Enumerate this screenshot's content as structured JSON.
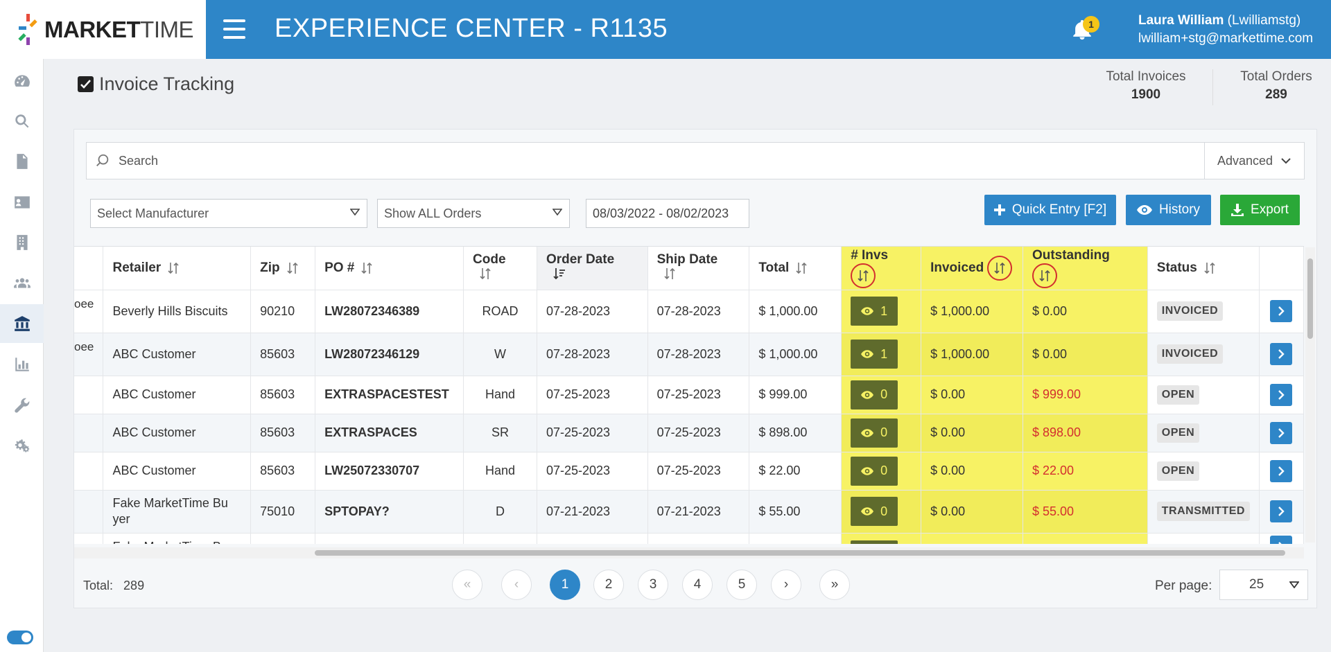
{
  "header": {
    "logo_bold": "MARKET",
    "logo_thin": "TIME",
    "app_title": "EXPERIENCE CENTER - R1135",
    "notification_count": "1",
    "user_name": "Laura William",
    "user_login": "(Lwilliamstg)",
    "user_email": "lwilliam+stg@markettime.com"
  },
  "sidebar": {
    "items": [
      {
        "icon": "dashboard-icon"
      },
      {
        "icon": "search-icon"
      },
      {
        "icon": "document-icon"
      },
      {
        "icon": "contact-card-icon"
      },
      {
        "icon": "building-icon"
      },
      {
        "icon": "users-icon"
      },
      {
        "icon": "bank-icon",
        "active": true
      },
      {
        "icon": "bar-chart-icon"
      },
      {
        "icon": "wrench-icon"
      },
      {
        "icon": "gears-icon"
      }
    ]
  },
  "page": {
    "title": "Invoice Tracking",
    "total_invoices_label": "Total Invoices",
    "total_invoices_value": "1900",
    "total_orders_label": "Total Orders",
    "total_orders_value": "289"
  },
  "filters": {
    "search_placeholder": "Search",
    "advanced_label": "Advanced",
    "manufacturer_placeholder": "Select Manufacturer",
    "orders_filter": "Show ALL Orders",
    "date_range": "08/03/2022 - 08/02/2023"
  },
  "actions": {
    "quick_entry": "Quick Entry [F2]",
    "history": "History",
    "export": "Export"
  },
  "table": {
    "columns": {
      "retailer": "Retailer",
      "zip": "Zip",
      "po": "PO #",
      "code": "Code",
      "order_date": "Order Date",
      "ship_date": "Ship Date",
      "total": "Total",
      "invs": "# Invs",
      "invoiced": "Invoiced",
      "outstanding": "Outstanding",
      "status": "Status"
    },
    "rows": [
      {
        "clip": "oee",
        "retailer": "Beverly Hills Biscuits",
        "zip": "90210",
        "po": "LW28072346389",
        "code": "ROAD",
        "order_date": "07-28-2023",
        "ship_date": "07-28-2023",
        "total": "$ 1,000.00",
        "invs": "1",
        "invoiced": "$ 1,000.00",
        "outstanding": "$ 0.00",
        "outstanding_red": false,
        "status": "INVOICED"
      },
      {
        "clip": "oee",
        "retailer": "ABC Customer",
        "zip": "85603",
        "po": "LW28072346129",
        "code": "W",
        "order_date": "07-28-2023",
        "ship_date": "07-28-2023",
        "total": "$ 1,000.00",
        "invs": "1",
        "invoiced": "$ 1,000.00",
        "outstanding": "$ 0.00",
        "outstanding_red": false,
        "status": "INVOICED"
      },
      {
        "clip": "",
        "retailer": "ABC Customer",
        "zip": "85603",
        "po": "EXTRASPACESTEST",
        "code": "Hand",
        "order_date": "07-25-2023",
        "ship_date": "07-25-2023",
        "total": "$ 999.00",
        "invs": "0",
        "invoiced": "$ 0.00",
        "outstanding": "$ 999.00",
        "outstanding_red": true,
        "status": "OPEN"
      },
      {
        "clip": "",
        "retailer": "ABC Customer",
        "zip": "85603",
        "po": "EXTRASPACES",
        "code": "SR",
        "order_date": "07-25-2023",
        "ship_date": "07-25-2023",
        "total": "$ 898.00",
        "invs": "0",
        "invoiced": "$ 0.00",
        "outstanding": "$ 898.00",
        "outstanding_red": true,
        "status": "OPEN"
      },
      {
        "clip": "",
        "retailer": "ABC Customer",
        "zip": "85603",
        "po": "LW25072330707",
        "code": "Hand",
        "order_date": "07-25-2023",
        "ship_date": "07-25-2023",
        "total": "$ 22.00",
        "invs": "0",
        "invoiced": "$ 0.00",
        "outstanding": "$ 22.00",
        "outstanding_red": true,
        "status": "OPEN"
      },
      {
        "clip": "",
        "retailer": "Fake MarketTime Bu yer",
        "zip": "75010",
        "po": "SPTOPAY?",
        "code": "D",
        "order_date": "07-21-2023",
        "ship_date": "07-21-2023",
        "total": "$ 55.00",
        "invs": "0",
        "invoiced": "$ 0.00",
        "outstanding": "$ 55.00",
        "outstanding_red": true,
        "status": "TRANSMITTED"
      },
      {
        "clip": "",
        "retailer": "Fake MarketTime Bu",
        "zip": "",
        "po": "",
        "code": "",
        "order_date": "",
        "ship_date": "",
        "total": "",
        "invs": "",
        "invoiced": "",
        "outstanding": "",
        "outstanding_red": true,
        "status": ""
      }
    ]
  },
  "pagination": {
    "total_label": "Total:",
    "total_value": "289",
    "pages": [
      "1",
      "2",
      "3",
      "4",
      "5"
    ],
    "current_page": "1",
    "first": "«",
    "prev": "‹",
    "next": "›",
    "last": "»",
    "per_page_label": "Per page:",
    "per_page_value": "25"
  },
  "colors": {
    "brand_blue": "#2e86c8",
    "export_green": "#2aa838",
    "highlight_yellow": "#f7f264",
    "outstanding_red": "#d32f2f"
  }
}
